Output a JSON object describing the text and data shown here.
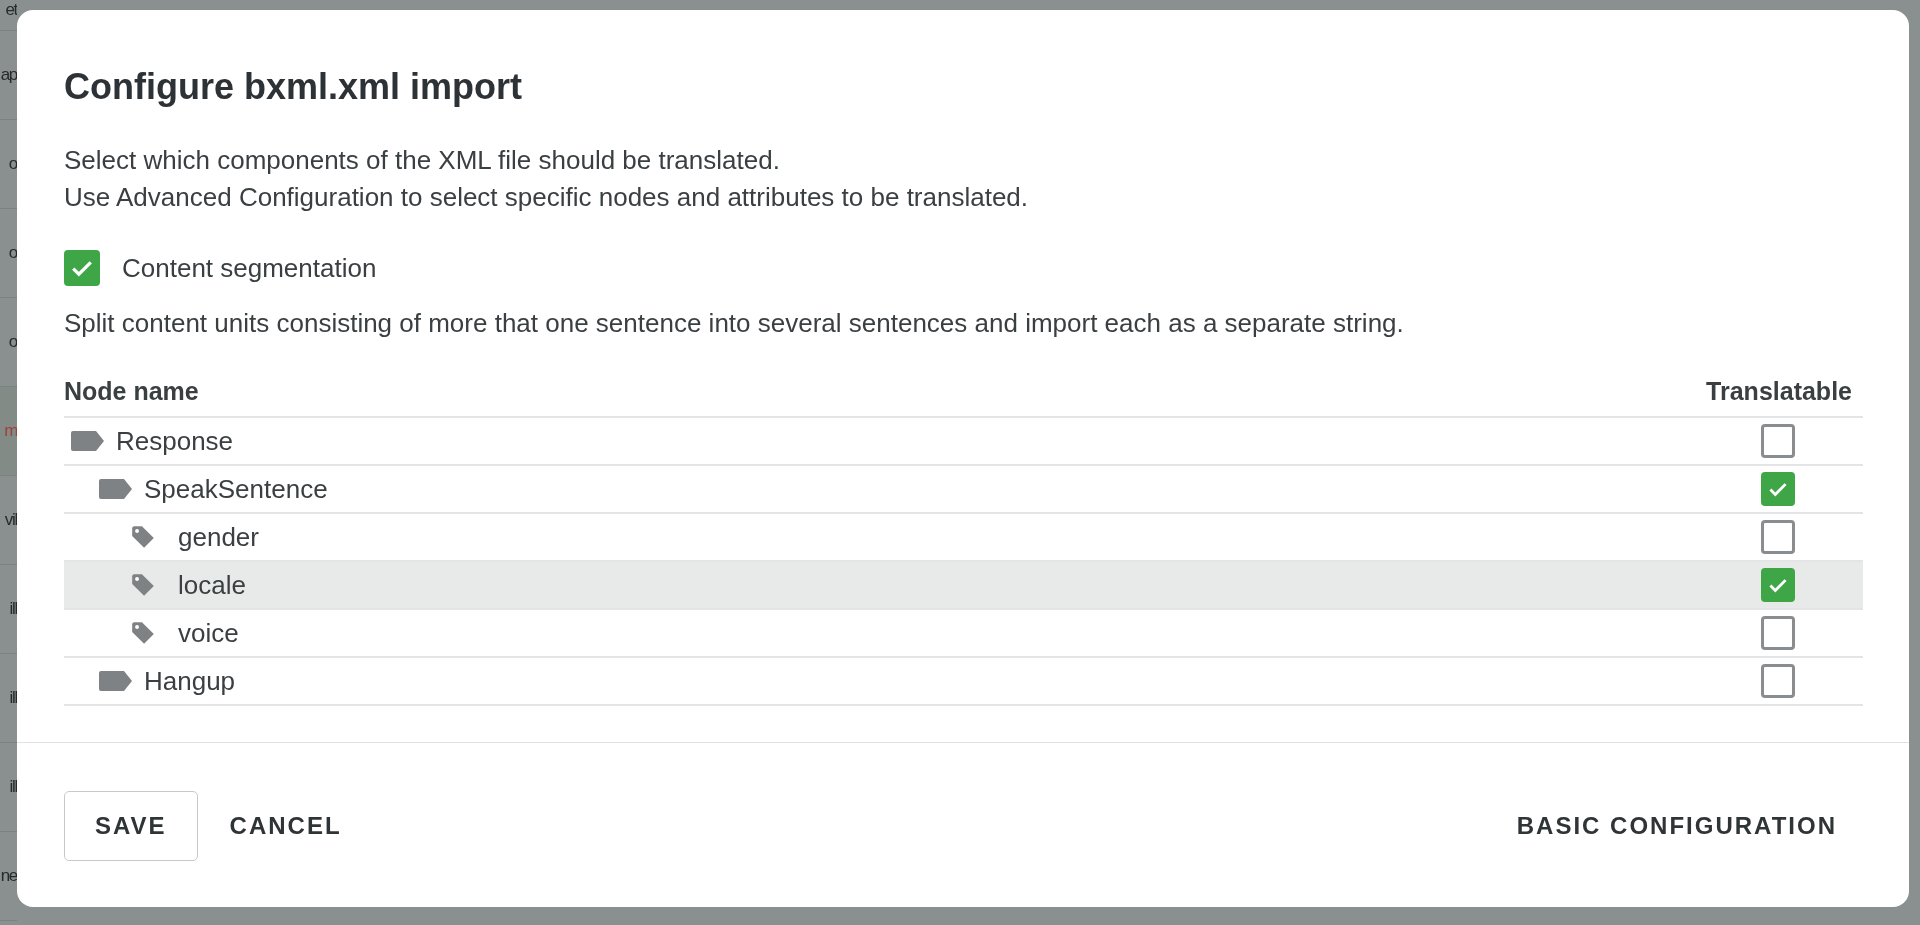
{
  "background_rows": [
    {
      "text": "et",
      "kind": "normal"
    },
    {
      "text": "ap",
      "kind": "normal"
    },
    {
      "text": "o",
      "kind": "normal"
    },
    {
      "text": "o",
      "kind": "normal"
    },
    {
      "text": "o",
      "kind": "normal"
    },
    {
      "text": "m",
      "kind": "alert"
    },
    {
      "text": "vil",
      "kind": "normal"
    },
    {
      "text": "ill",
      "kind": "normal"
    },
    {
      "text": "ill",
      "kind": "normal"
    },
    {
      "text": "ill",
      "kind": "normal"
    },
    {
      "text": "ne",
      "kind": "normal"
    }
  ],
  "dialog": {
    "title": "Configure bxml.xml import",
    "description": [
      "Select which components of the XML file should be translated.",
      "Use Advanced Configuration to select specific nodes and attributes to be translated."
    ],
    "segmentation": {
      "label": "Content segmentation",
      "checked": true,
      "hint": "Split content units consisting of more that one sentence into several sentences and import each as a separate string."
    },
    "table": {
      "columns": [
        "Node name",
        "Translatable"
      ],
      "nodes": [
        {
          "name": "Response",
          "kind": "node",
          "checked": false,
          "selected": false,
          "children": [
            {
              "name": "SpeakSentence",
              "kind": "node",
              "checked": true,
              "selected": false,
              "children": [
                {
                  "name": "gender",
                  "kind": "attribute",
                  "checked": false,
                  "selected": false
                },
                {
                  "name": "locale",
                  "kind": "attribute",
                  "checked": true,
                  "selected": true
                },
                {
                  "name": "voice",
                  "kind": "attribute",
                  "checked": false,
                  "selected": false
                }
              ]
            },
            {
              "name": "Hangup",
              "kind": "node",
              "checked": false,
              "selected": false
            }
          ]
        }
      ]
    },
    "buttons": {
      "save": "SAVE",
      "cancel": "CANCEL",
      "mode": "BASIC CONFIGURATION"
    }
  }
}
